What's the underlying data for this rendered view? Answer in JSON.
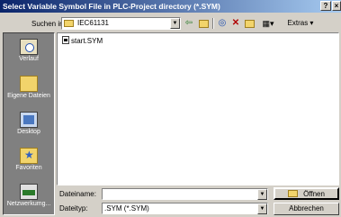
{
  "window": {
    "title": "Select Variable Symbol File in PLC-Project directory (*.SYM)",
    "help_label": "?",
    "close_label": "×"
  },
  "lookin": {
    "label": "Suchen in:",
    "value": "IEC61131"
  },
  "toolbar": {
    "back_icon": "back-arrow-icon",
    "up_icon": "up-folder-icon",
    "search_icon": "search-web-icon",
    "delete_icon": "delete-icon",
    "new_folder_icon": "new-folder-icon",
    "view_icon": "view-menu-icon",
    "extras_label": "Extras ▾"
  },
  "places": [
    {
      "label": "Verlauf",
      "icon": "history-icon"
    },
    {
      "label": "Eigene Dateien",
      "icon": "my-documents-icon"
    },
    {
      "label": "Desktop",
      "icon": "desktop-icon"
    },
    {
      "label": "Favoriten",
      "icon": "favorites-icon"
    },
    {
      "label": "Netzwerkumg...",
      "icon": "network-icon"
    }
  ],
  "files": [
    {
      "name": "start.SYM"
    }
  ],
  "filename": {
    "label": "Dateiname:",
    "value": ""
  },
  "filetype": {
    "label": "Dateityp:",
    "value": ".SYM (*.SYM)"
  },
  "buttons": {
    "open": "Öffnen",
    "cancel": "Abbrechen"
  }
}
